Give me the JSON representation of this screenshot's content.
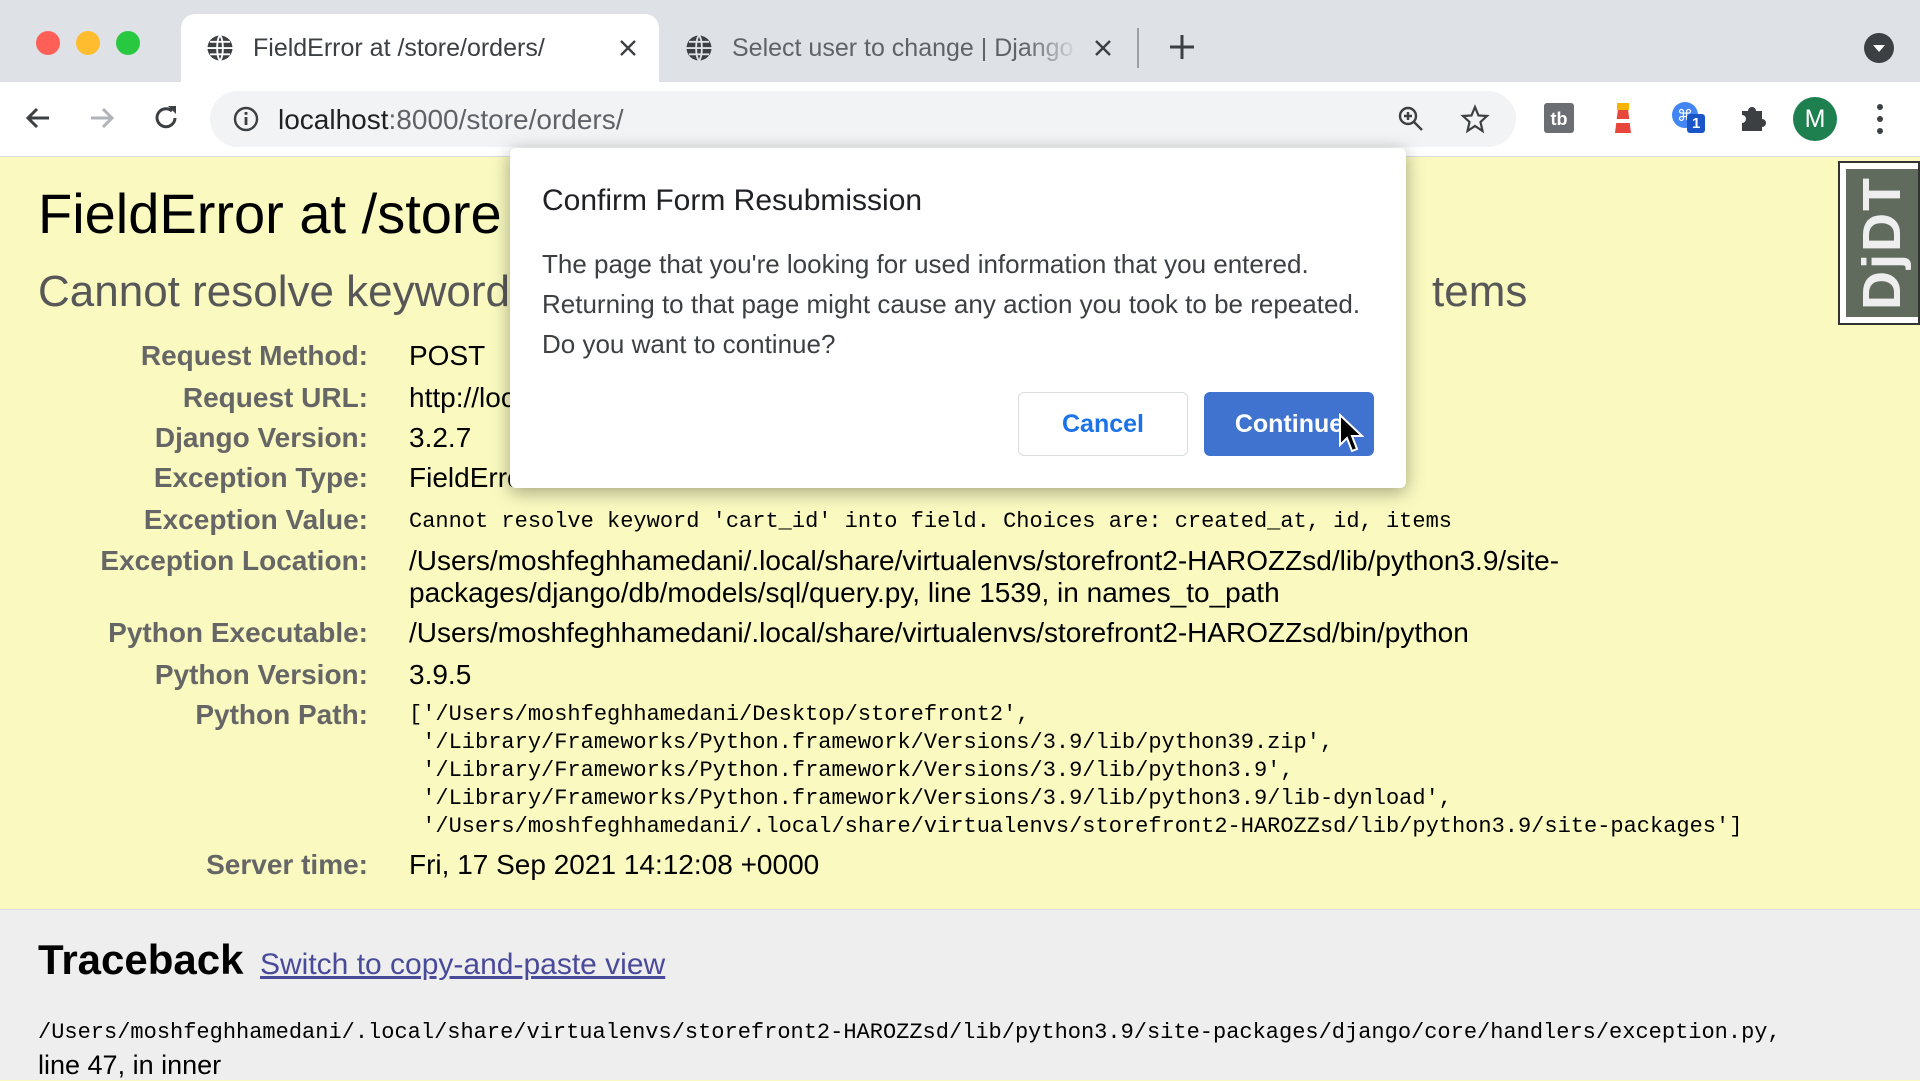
{
  "browser": {
    "tabs": [
      {
        "title": "FieldError at /store/orders/",
        "active": true
      },
      {
        "title": "Select user to change | Django",
        "active": false
      }
    ],
    "url_host": "localhost",
    "url_path": ":8000/store/orders/",
    "avatar_letter": "M",
    "extension_badge": "1"
  },
  "error": {
    "title": "FieldError at /store",
    "subtitle": "Cannot resolve keyword",
    "subtitle_tail": "tems",
    "rows": [
      {
        "label": "Request Method:",
        "value": "POST"
      },
      {
        "label": "Request URL:",
        "value": "http://loc"
      },
      {
        "label": "Django Version:",
        "value": "3.2.7"
      },
      {
        "label": "Exception Type:",
        "value": "FieldErro"
      },
      {
        "label": "Exception Value:",
        "value": "Cannot resolve keyword 'cart_id' into field. Choices are: created_at, id, items"
      },
      {
        "label": "Exception Location:",
        "value": "/Users/moshfeghhamedani/.local/share/virtualenvs/storefront2-HAROZZsd/lib/python3.9/site-",
        "value2": "packages/django/db/models/sql/query.py, line 1539, in names_to_path"
      },
      {
        "label": "Python Executable:",
        "value": "/Users/moshfeghhamedani/.local/share/virtualenvs/storefront2-HAROZZsd/bin/python"
      },
      {
        "label": "Python Version:",
        "value": "3.9.5"
      },
      {
        "label": "Python Path:",
        "value": "['/Users/moshfeghhamedani/Desktop/storefront2',\n '/Library/Frameworks/Python.framework/Versions/3.9/lib/python39.zip',\n '/Library/Frameworks/Python.framework/Versions/3.9/lib/python3.9',\n '/Library/Frameworks/Python.framework/Versions/3.9/lib/python3.9/lib-dynload',\n '/Users/moshfeghhamedani/.local/share/virtualenvs/storefront2-HAROZZsd/lib/python3.9/site-packages']"
      },
      {
        "label": "Server time:",
        "value": "Fri, 17 Sep 2021 14:12:08 +0000"
      }
    ],
    "djdt": "DjDT"
  },
  "traceback": {
    "title": "Traceback",
    "link": "Switch to copy-and-paste view",
    "file": "/Users/moshfeghhamedani/.local/share/virtualenvs/storefront2-HAROZZsd/lib/python3.9/site-packages/django/core/handlers/exception.py,",
    "line": "line 47, in inner"
  },
  "dialog": {
    "title": "Confirm Form Resubmission",
    "body": "The page that you're looking for used information that you entered. Returning to that page might cause any action you took to be repeated. Do you want to continue?",
    "cancel": "Cancel",
    "continue": "Continue"
  },
  "colors": {
    "accent": "#3f73cf",
    "page_bg": "#f9f9c0"
  }
}
